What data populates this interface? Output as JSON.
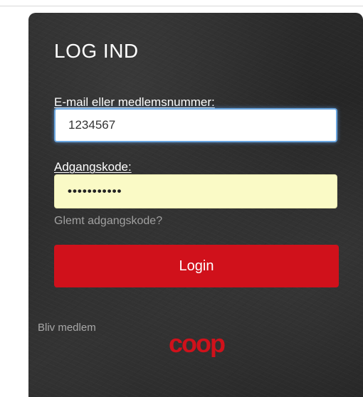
{
  "login": {
    "title": "LOG IND",
    "email_label": "E-mail eller medlemsnummer:",
    "email_value": "1234567",
    "password_label": "Adgangskode:",
    "password_value": "•••••••••••",
    "forgot_label": "Glemt adgangskode?",
    "login_button": "Login",
    "join_label": "Bliv medlem",
    "logo_text": "coop"
  },
  "colors": {
    "panel_bg": "#2b2b2b",
    "accent_red": "#d0111b",
    "focus_blue": "#6aa6e0",
    "password_fill": "#fafac6"
  },
  "icons": {
    "logo": "coop-logo"
  }
}
